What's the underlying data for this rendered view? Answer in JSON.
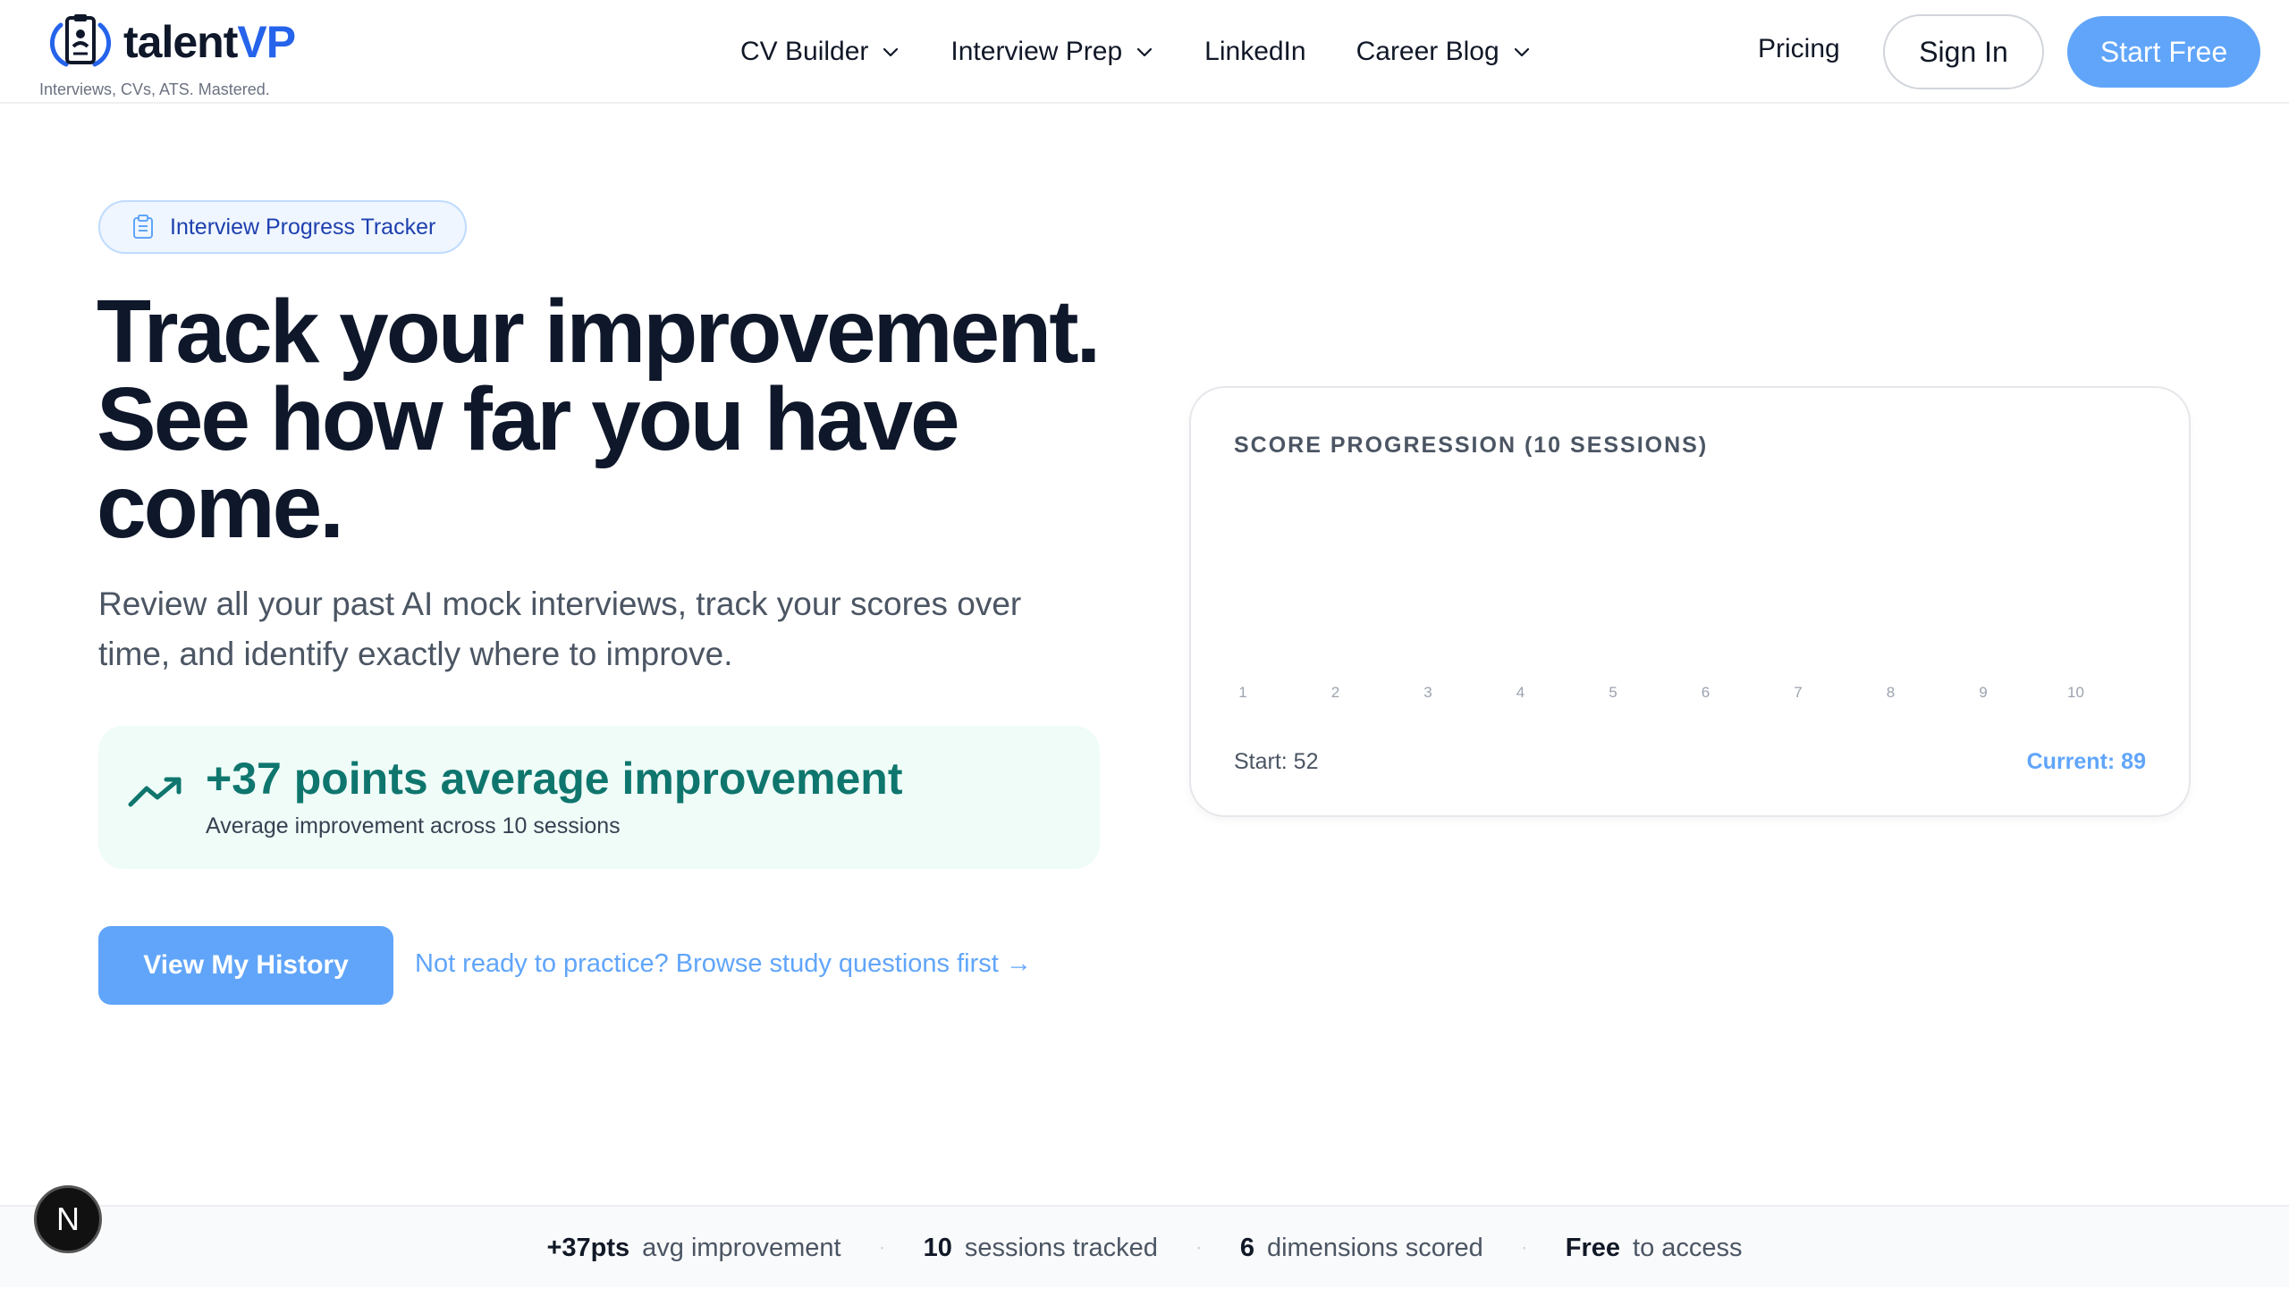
{
  "header": {
    "logo_prefix": "talent",
    "logo_suffix": "VP",
    "tagline": "Interviews, CVs, ATS. Mastered.",
    "nav": [
      {
        "label": "CV Builder",
        "dropdown": true
      },
      {
        "label": "Interview Prep",
        "dropdown": true
      },
      {
        "label": "LinkedIn",
        "dropdown": false
      },
      {
        "label": "Career Blog",
        "dropdown": true
      }
    ],
    "pricing": "Pricing",
    "signin": "Sign In",
    "start_free": "Start Free"
  },
  "hero": {
    "pill_label": "Interview Progress Tracker",
    "headline_line1": "Track your improvement.",
    "headline_line2": "See how far you have",
    "headline_line3": "come.",
    "subtext": "Review all your past AI mock interviews, track your scores over time, and identify exactly where to improve.",
    "improvement_title": "+37 points average improvement",
    "improvement_sub": "Average improvement across 10 sessions",
    "history_button": "View My History",
    "study_link": "Not ready to practice? Browse study questions first →"
  },
  "chart_card": {
    "title": "SCORE PROGRESSION (10 SESSIONS)",
    "start_label": "Start: 52",
    "current_label": "Current: 89"
  },
  "chart_data": {
    "type": "bar",
    "categories": [
      "1",
      "2",
      "3",
      "4",
      "5",
      "6",
      "7",
      "8",
      "9",
      "10"
    ],
    "values": [],
    "title": "SCORE PROGRESSION (10 SESSIONS)",
    "xlabel": "",
    "ylabel": ""
  },
  "stats": [
    {
      "value": "+37pts",
      "label": "avg improvement"
    },
    {
      "value": "10",
      "label": "sessions tracked"
    },
    {
      "value": "6",
      "label": "dimensions scored"
    },
    {
      "value": "Free",
      "label": "to access"
    }
  ],
  "badge_letter": "N",
  "colors": {
    "accent": "#60a5fa",
    "brand": "#2563eb",
    "success": "#0f766e",
    "headline": "#0f172a"
  },
  "icons": {
    "pill": "clipboard-icon",
    "improvement": "trending-up-icon",
    "nav_dropdown": "chevron-down-icon"
  }
}
